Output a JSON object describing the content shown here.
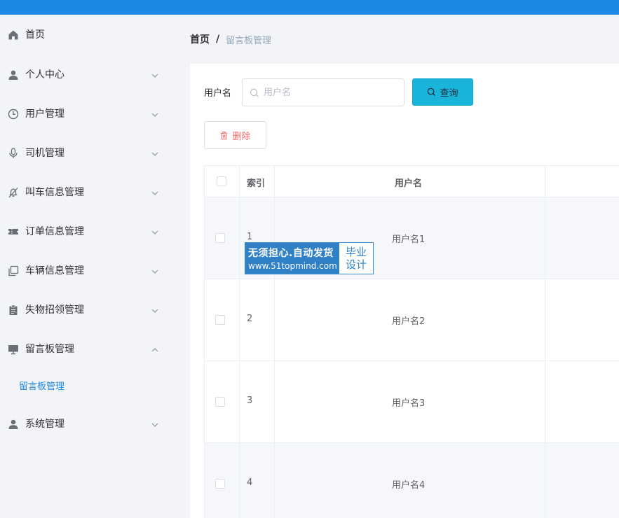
{
  "sidebar": {
    "items": [
      {
        "label": "首页",
        "icon": "home-icon"
      },
      {
        "label": "个人中心",
        "icon": "user-icon"
      },
      {
        "label": "用户管理",
        "icon": "clock-icon"
      },
      {
        "label": "司机管理",
        "icon": "microphone-icon"
      },
      {
        "label": "叫车信息管理",
        "icon": "bell-off-icon"
      },
      {
        "label": "订单信息管理",
        "icon": "ticket-icon"
      },
      {
        "label": "车辆信息管理",
        "icon": "copy-icon"
      },
      {
        "label": "失物招领管理",
        "icon": "clipboard-icon"
      },
      {
        "label": "留言板管理",
        "icon": "monitor-icon"
      },
      {
        "label": "系统管理",
        "icon": "user-icon"
      }
    ],
    "active_submenu": "留言板管理"
  },
  "breadcrumb": {
    "home": "首页",
    "separator": "/",
    "current": "留言板管理"
  },
  "search": {
    "label": "用户名",
    "placeholder": "用户名",
    "value": "",
    "query_button": "查询"
  },
  "toolbar": {
    "delete_button": "删除"
  },
  "table": {
    "columns": [
      "索引",
      "用户名"
    ],
    "rows": [
      {
        "index": "1",
        "username": "用户名1"
      },
      {
        "index": "2",
        "username": "用户名2"
      },
      {
        "index": "3",
        "username": "用户名3"
      },
      {
        "index": "4",
        "username": "用户名4"
      }
    ]
  },
  "watermark": {
    "line1": "无须担心.自动发货",
    "line2": "www.51topmind.com",
    "right1": "毕业",
    "right2": "设计"
  },
  "colors": {
    "topbar": "#1e88e5",
    "accent": "#1e88e5",
    "query_button": "#1ab3d9",
    "danger": "#f56c6c"
  }
}
